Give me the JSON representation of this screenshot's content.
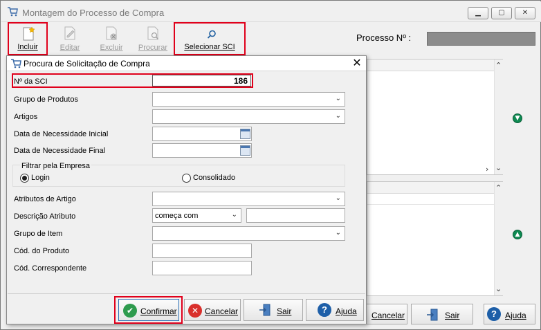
{
  "main": {
    "title": "Montagem do Processo de Compra",
    "toolbar": {
      "incluir": "Incluir",
      "editar": "Editar",
      "excluir": "Excluir",
      "procurar": "Procurar",
      "selecionar_sci": "Selecionar SCI"
    },
    "processo_label": "Processo Nº :",
    "buttons": {
      "cancelar": "Cancelar",
      "sair": "Sair",
      "ajuda": "Ajuda"
    }
  },
  "dialog": {
    "title": "Procura de Solicitação de Compra",
    "fields": {
      "n_sci_label": "Nº da SCI",
      "n_sci_value": "186",
      "grupo_produtos_label": "Grupo de Produtos",
      "artigos_label": "Artigos",
      "data_inicial_label": "Data de Necessidade Inicial",
      "data_final_label": "Data de Necessidade Final",
      "filtrar_empresa_label": "Filtrar pela Empresa",
      "radio_login": "Login",
      "radio_consolidado": "Consolidado",
      "atributos_artigo_label": "Atributos de Artigo",
      "descricao_atributo_label": "Descrição Atributo",
      "descricao_atributo_operator": "começa com",
      "grupo_item_label": "Grupo de Item",
      "cod_produto_label": "Cód. do Produto",
      "cod_correspondente_label": "Cód. Correspondente"
    },
    "buttons": {
      "confirmar": "Confirmar",
      "cancelar": "Cancelar",
      "sair": "Sair",
      "ajuda": "Ajuda"
    }
  },
  "colors": {
    "highlight_red": "#e0001b",
    "confirm_green": "#2e9b4e",
    "cancel_red": "#d9302c",
    "help_blue": "#1e5fa8"
  }
}
